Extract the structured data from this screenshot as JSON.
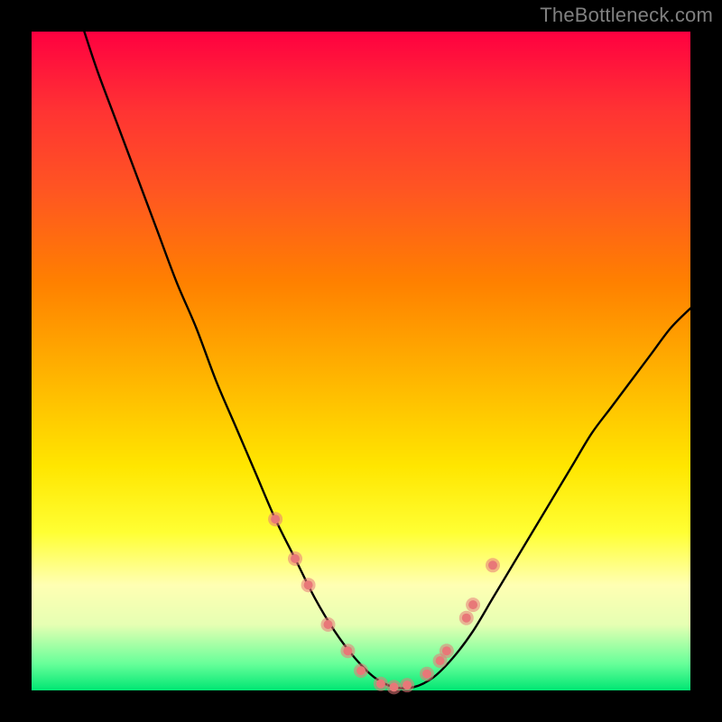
{
  "watermark": "TheBottleneck.com",
  "chart_data": {
    "type": "line",
    "title": "",
    "xlabel": "",
    "ylabel": "",
    "xlim": [
      0,
      100
    ],
    "ylim": [
      0,
      100
    ],
    "grid": false,
    "legend": false,
    "annotations": [],
    "series": [
      {
        "name": "bottleneck-curve",
        "color": "#000000",
        "x": [
          8,
          10,
          13,
          16,
          19,
          22,
          25,
          28,
          31,
          34,
          37,
          40,
          43,
          46,
          49,
          52,
          55,
          58,
          61,
          64,
          67,
          70,
          73,
          76,
          79,
          82,
          85,
          88,
          91,
          94,
          97,
          100
        ],
        "y": [
          100,
          94,
          86,
          78,
          70,
          62,
          55,
          47,
          40,
          33,
          26,
          20,
          14,
          9,
          5,
          2,
          0.5,
          0.5,
          2,
          5,
          9,
          14,
          19,
          24,
          29,
          34,
          39,
          43,
          47,
          51,
          55,
          58
        ]
      }
    ],
    "markers": {
      "name": "highlight-points",
      "color": "#e87878",
      "radius_outer": 8,
      "radius_inner": 5,
      "points_x": [
        37,
        40,
        42,
        45,
        48,
        50,
        53,
        55,
        57,
        60,
        62,
        63,
        66,
        67,
        70
      ],
      "points_y": [
        26,
        20,
        16,
        10,
        6,
        3,
        1,
        0.5,
        0.8,
        2.5,
        4.5,
        6,
        11,
        13,
        19
      ]
    }
  }
}
